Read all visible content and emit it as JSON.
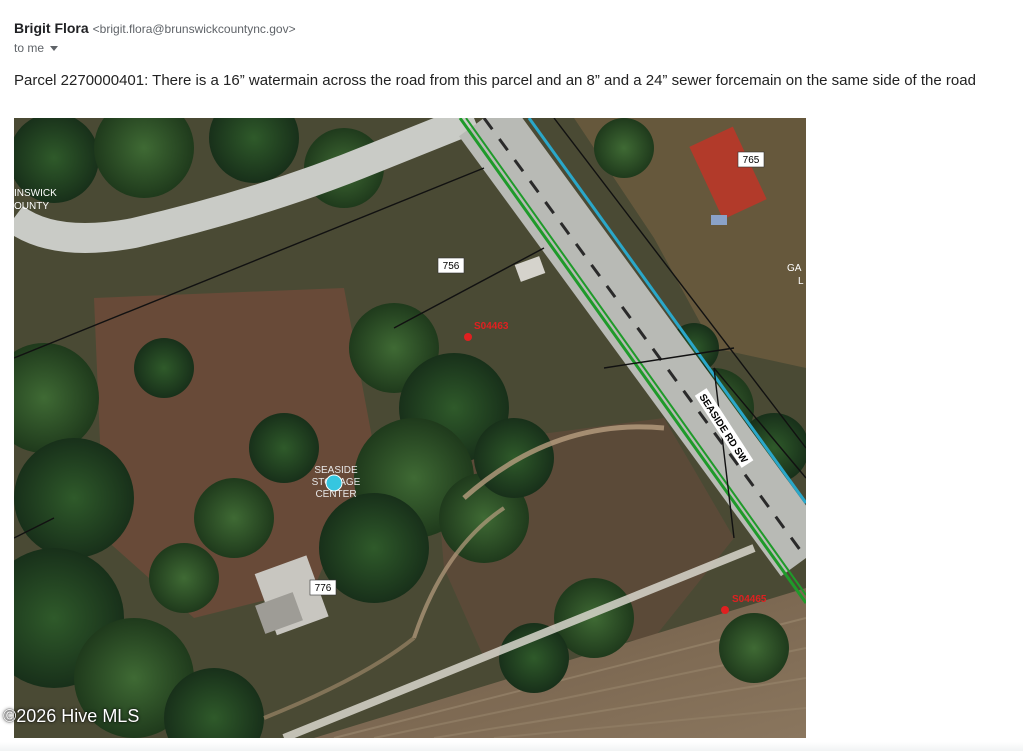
{
  "email": {
    "sender_name": "Brigit Flora",
    "sender_email": "<brigit.flora@brunswickcountync.gov>",
    "recipient": "to me",
    "body": "Parcel 2270000401: There is a 16” watermain across the road from this parcel and an 8” and a 24” sewer forcemain on the same side of the road"
  },
  "map": {
    "labels": {
      "address_765": "765",
      "address_756": "756",
      "address_776": "776",
      "road_name": "SEASIDE RD SW",
      "sewer_node_1": "S04463",
      "sewer_node_2": "S04465",
      "place_line_1": "SEASIDE",
      "place_line_2": "STORAGE",
      "place_line_3": "CENTER",
      "edge_label_1": "INSWICK",
      "edge_label_2": "OUNTY",
      "edge_label_3": "GA",
      "edge_label_4": "L"
    },
    "colors": {
      "watermain": "#2aa7c9",
      "sewer_forcemain": "#1f9a2a",
      "sewer_node": "#e02020",
      "place_marker": "#36c6e0"
    },
    "icons": {
      "place_marker": "map-pin-circle-icon",
      "sewer_node": "sewer-node-icon"
    }
  },
  "watermark": "©2026 Hive MLS"
}
